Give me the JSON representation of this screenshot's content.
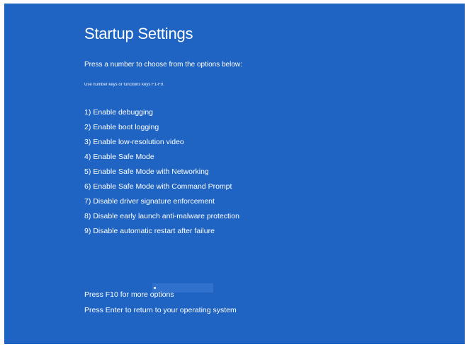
{
  "screen": {
    "title": "Startup Settings",
    "prompt": "Press a number to choose from the options below:",
    "hint": "Use number keys or functions keys F1-F9.",
    "options": [
      {
        "key": "1)",
        "label": "Enable debugging"
      },
      {
        "key": "2)",
        "label": "Enable boot logging"
      },
      {
        "key": "3)",
        "label": "Enable low-resolution video"
      },
      {
        "key": "4)",
        "label": "Enable Safe Mode"
      },
      {
        "key": "5)",
        "label": "Enable Safe Mode with Networking"
      },
      {
        "key": "6)",
        "label": "Enable Safe Mode with Command Prompt"
      },
      {
        "key": "7)",
        "label": "Disable driver signature enforcement"
      },
      {
        "key": "8)",
        "label": "Disable early launch anti-malware protection"
      },
      {
        "key": "9)",
        "label": "Disable automatic restart after failure"
      }
    ],
    "footer": {
      "more_options": "Press F10 for more options",
      "return": "Press Enter to return to your operating system"
    }
  },
  "colors": {
    "background": "#1f64c3",
    "text": "#ffffff"
  }
}
